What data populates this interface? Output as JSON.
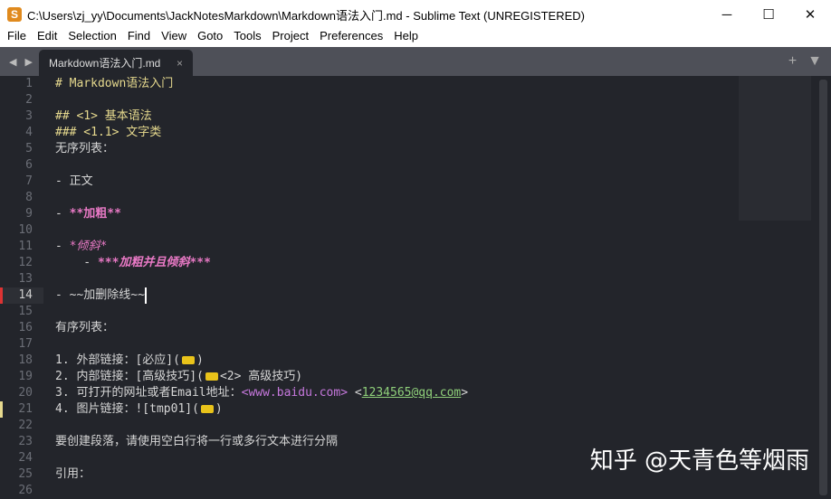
{
  "window": {
    "title": "C:\\Users\\zj_yy\\Documents\\JackNotesMarkdown\\Markdown语法入门.md - Sublime Text (UNREGISTERED)",
    "icon": "S",
    "minimize": "─",
    "maximize": "☐",
    "close": "✕"
  },
  "menu": [
    "File",
    "Edit",
    "Selection",
    "Find",
    "View",
    "Goto",
    "Tools",
    "Project",
    "Preferences",
    "Help"
  ],
  "tabs": {
    "active": "Markdown语法入门.md",
    "close": "×",
    "nav": "◀ ▶",
    "new": "+",
    "dropdown": "▼"
  },
  "lines": [
    {
      "n": "1",
      "parts": [
        [
          "h",
          "# Markdown语法入门"
        ]
      ]
    },
    {
      "n": "2",
      "parts": []
    },
    {
      "n": "3",
      "parts": [
        [
          "h",
          "## <1> 基本语法"
        ]
      ]
    },
    {
      "n": "4",
      "parts": [
        [
          "h",
          "### <1.1> 文字类"
        ]
      ]
    },
    {
      "n": "5",
      "parts": [
        [
          "",
          "无序列表："
        ]
      ]
    },
    {
      "n": "6",
      "parts": []
    },
    {
      "n": "7",
      "parts": [
        [
          "",
          "- 正文"
        ]
      ]
    },
    {
      "n": "8",
      "parts": []
    },
    {
      "n": "9",
      "parts": [
        [
          "",
          "- "
        ],
        [
          "b",
          "**加粗**"
        ]
      ]
    },
    {
      "n": "10",
      "parts": []
    },
    {
      "n": "11",
      "parts": [
        [
          "",
          "- "
        ],
        [
          "i",
          "*倾斜*"
        ]
      ]
    },
    {
      "n": "12",
      "parts": [
        [
          "",
          "    - "
        ],
        [
          "i b",
          "***加粗并且倾斜***"
        ]
      ]
    },
    {
      "n": "13",
      "parts": []
    },
    {
      "n": "14",
      "parts": [
        [
          "",
          "- ~~加删除线~~"
        ],
        [
          "caret",
          ""
        ]
      ]
    },
    {
      "n": "15",
      "parts": []
    },
    {
      "n": "16",
      "parts": [
        [
          "",
          "有序列表："
        ]
      ]
    },
    {
      "n": "17",
      "parts": []
    },
    {
      "n": "18",
      "parts": [
        [
          "",
          "1. 外部链接：[必应]("
        ],
        [
          "dots",
          ""
        ],
        [
          "",
          ")"
        ]
      ]
    },
    {
      "n": "19",
      "parts": [
        [
          "",
          "2. 内部链接：[高级技巧]("
        ],
        [
          "dots",
          ""
        ],
        [
          "",
          "<2> 高级技巧)"
        ]
      ]
    },
    {
      "n": "20",
      "parts": [
        [
          "",
          "3. 可打开的网址或者Email地址："
        ],
        [
          "url",
          "<www.baidu.com>"
        ],
        [
          "",
          " <"
        ],
        [
          "mail",
          "1234565@qq.com"
        ],
        [
          "",
          ">"
        ]
      ]
    },
    {
      "n": "21",
      "parts": [
        [
          "",
          "4. 图片链接：![tmp01]("
        ],
        [
          "dots",
          ""
        ],
        [
          "",
          ")"
        ]
      ]
    },
    {
      "n": "22",
      "parts": []
    },
    {
      "n": "23",
      "parts": [
        [
          "",
          "要创建段落，请使用空白行将一行或多行文本进行分隔"
        ]
      ]
    },
    {
      "n": "24",
      "parts": []
    },
    {
      "n": "25",
      "parts": [
        [
          "",
          "引用："
        ]
      ]
    },
    {
      "n": "26",
      "parts": []
    }
  ],
  "current_line": "14",
  "watermark": "知乎 @天青色等烟雨"
}
